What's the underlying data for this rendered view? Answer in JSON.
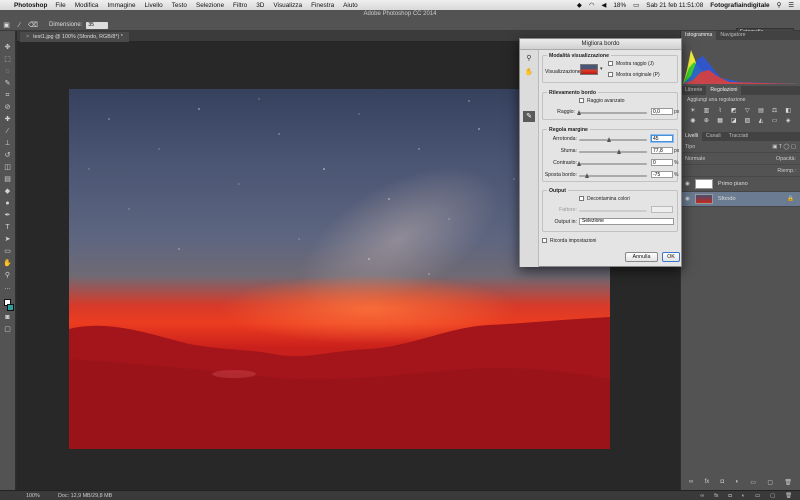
{
  "menubar": {
    "app_name": "Photoshop",
    "menus": [
      "File",
      "Modifica",
      "Immagine",
      "Livello",
      "Testo",
      "Selezione",
      "Filtro",
      "3D",
      "Visualizza",
      "Finestra",
      "Aiuto"
    ],
    "battery": "18%",
    "datetime": "Sab 21 feb  11:51:08",
    "user": "Fotografiaindigitale"
  },
  "window": {
    "title": "Adobe Photoshop CC 2014"
  },
  "options": {
    "size_label": "Dimensione:",
    "size_value": "35",
    "workspace": "Fotografia"
  },
  "document": {
    "tab_title": "test1.jpg @ 100% (Sfondo, RGB/8*) *"
  },
  "status": {
    "zoom": "100%",
    "doc_info": "Doc: 12,9 MB/29,8 MB"
  },
  "panels": {
    "top_tabs": [
      "Istogramma",
      "Navigatore"
    ],
    "adj_tabs": [
      "Librerie",
      "Regolazioni"
    ],
    "adj_hint": "Aggiungi una regolazione",
    "layer_tabs": [
      "Livelli",
      "Canali",
      "Tracciati"
    ],
    "kind_label": "Tipo",
    "blend_mode": "Normale",
    "opacity_label": "Opacità:",
    "fill_label": "Riemp.:",
    "layers": [
      {
        "name": "Primo piano",
        "selected": false
      },
      {
        "name": "Sfondo",
        "selected": true
      }
    ]
  },
  "dialog": {
    "title": "Migliora bordo",
    "view_mode": {
      "title": "Modalità visualizzazione",
      "view_label": "Visualizzazione:",
      "show_radius": "Mostra raggio (J)",
      "show_original": "Mostra originale (P)"
    },
    "edge_detection": {
      "title": "Rilevamento bordo",
      "smart_radius": "Raggio avanzato",
      "radius_label": "Raggio:",
      "radius_value": "0,0",
      "radius_unit": "px"
    },
    "adjust_edge": {
      "title": "Regola margine",
      "smooth_label": "Arrotonda:",
      "smooth_value": "45",
      "feather_label": "Sfuma:",
      "feather_value": "77,8",
      "feather_unit": "px",
      "contrast_label": "Contrasto:",
      "contrast_value": "0",
      "contrast_unit": "%",
      "shift_label": "Sposta bordo:",
      "shift_value": "-75",
      "shift_unit": "%"
    },
    "output": {
      "title": "Output",
      "decontaminate": "Decontamina colori",
      "amount_label": "Fattore:",
      "output_to_label": "Output in:",
      "output_to_value": "Selezione"
    },
    "remember": "Ricorda impostazioni",
    "cancel": "Annulla",
    "ok": "OK"
  }
}
